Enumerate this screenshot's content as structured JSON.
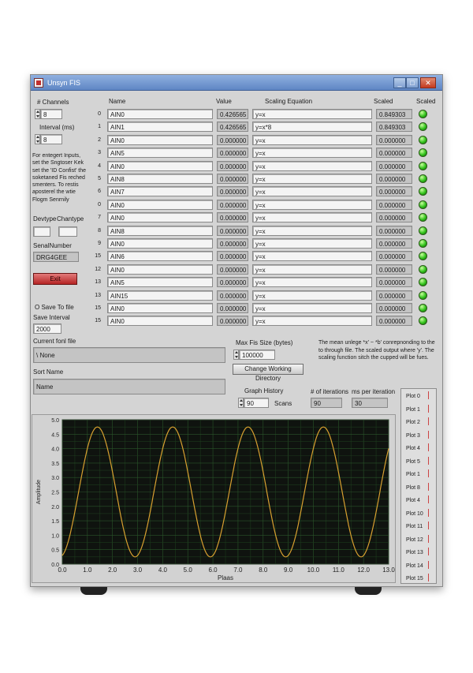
{
  "window": {
    "title": "Unsyn FIS"
  },
  "left_panel": {
    "channels_label": "# Channels",
    "channels_value": "8",
    "interval_label": "Interval (ms)",
    "interval_value": "8",
    "note": "For entegert Inputs, set the Sngtoser Kek set the 'ID Confist' the soketaned Fis reched smenters. To restis aposterel the wtie Flogm Senrnily",
    "devtype_label": "Devtype",
    "chantype_label": "Chantype",
    "devtype_value": "",
    "chantype_value": "",
    "serialnumber_label": "SenalNumber",
    "serialnumber_value": "DRG4GEE",
    "exit_label": "Exit",
    "save_label": "O Save To file",
    "save_interval_label": "Save Interval",
    "save_interval_value": "2000"
  },
  "table": {
    "headers": {
      "name": "Name",
      "value": "Value",
      "scaling": "Scaling Equation",
      "scaled": "Scaled",
      "status": "Scaled"
    },
    "rows": [
      {
        "idx": "0",
        "name": "AIN0",
        "value": "0.426565",
        "scaling": "y=x",
        "scaled": "0.849303"
      },
      {
        "idx": "1",
        "name": "AIN1",
        "value": "0.426565",
        "scaling": "y=x*8",
        "scaled": "0.849303"
      },
      {
        "idx": "2",
        "name": "AIN0",
        "value": "0.000000",
        "scaling": "y=x",
        "scaled": "0.000000"
      },
      {
        "idx": "3",
        "name": "AIN5",
        "value": "0.000000",
        "scaling": "y=x",
        "scaled": "0.000000"
      },
      {
        "idx": "4",
        "name": "AIN0",
        "value": "0.000000",
        "scaling": "y=x",
        "scaled": "0.000000"
      },
      {
        "idx": "5",
        "name": "AIN8",
        "value": "0.000000",
        "scaling": "y=x",
        "scaled": "0.000000"
      },
      {
        "idx": "6",
        "name": "AIN7",
        "value": "0.000000",
        "scaling": "y=x",
        "scaled": "0.000000"
      },
      {
        "idx": "0",
        "name": "AIN0",
        "value": "0.000000",
        "scaling": "y=x",
        "scaled": "0.000000"
      },
      {
        "idx": "7",
        "name": "AIN0",
        "value": "0.000000",
        "scaling": "y=x",
        "scaled": "0.000000"
      },
      {
        "idx": "8",
        "name": "AIN8",
        "value": "0.000000",
        "scaling": "y=x",
        "scaled": "0.000000"
      },
      {
        "idx": "9",
        "name": "AIN0",
        "value": "0.000000",
        "scaling": "y=x",
        "scaled": "0.000000"
      },
      {
        "idx": "15",
        "name": "AIN6",
        "value": "0.000000",
        "scaling": "y=x",
        "scaled": "0.000000"
      },
      {
        "idx": "12",
        "name": "AIN0",
        "value": "0.000000",
        "scaling": "y=x",
        "scaled": "0.000000"
      },
      {
        "idx": "13",
        "name": "AIN5",
        "value": "0.000000",
        "scaling": "y=x",
        "scaled": "0.000000"
      },
      {
        "idx": "13",
        "name": "AIN15",
        "value": "0.000000",
        "scaling": "y=x",
        "scaled": "0.000000"
      },
      {
        "idx": "15",
        "name": "AIN0",
        "value": "0.000000",
        "scaling": "y=x",
        "scaled": "0.000000"
      },
      {
        "idx": "15",
        "name": "AIN0",
        "value": "0.000000",
        "scaling": "y=x",
        "scaled": "0.000000"
      }
    ]
  },
  "middle": {
    "current_file_label": "Current fonl file",
    "current_file_value": "\\ None",
    "short_name_label": "Sort Name",
    "short_name_value": "Name",
    "max_size_label": "Max Fis Size (bytes)",
    "max_size_value": "100000",
    "change_dir_label": "Change Working Directory",
    "help_text": "The mean unlege *x' ~ *b' conrepnonding to the to through file. The scaled output where 'y'. The scaling function sitch the cupped will be fues.",
    "graph_history_label": "Graph History",
    "graph_history_value": "90",
    "graph_history_unit": "Scans",
    "num_iterations_label": "# of iterations",
    "num_iterations_value": "90",
    "ms_per_iteration_label": "ms per iteration",
    "ms_per_iteration_value": "30"
  },
  "plots": [
    "Plot 0",
    "Plot 1",
    "Plot 2",
    "Plot 3",
    "Plot 4",
    "Plot 5",
    "Plot 1",
    "Plot 8",
    "Plot 4",
    "Plot 10",
    "Plot 11",
    "Plot 12",
    "Plot 13",
    "Plot 14",
    "Plot 15"
  ],
  "colors": {
    "led_on": "#32c21c",
    "plot_bg": "#0f130f",
    "trace": "#d8a030",
    "exit": "#c43030"
  },
  "chart_data": {
    "type": "line",
    "xlabel": "Plaas",
    "ylabel": "Amplitude",
    "xlim": [
      0,
      130
    ],
    "ylim": [
      0,
      5
    ],
    "xticks": [
      "0.0",
      "1.0",
      "2.0",
      "3.0",
      "4.0",
      "5.0",
      "6.0",
      "7.0",
      "8.0",
      "9.0",
      "10.0",
      "11.0",
      "12.0",
      "13.0"
    ],
    "yticks": [
      "0.0",
      "0.5",
      "1.0",
      "1.5",
      "2.0",
      "2.5",
      "3.0",
      "3.5",
      "4.0",
      "4.5",
      "5.0"
    ],
    "grid": true,
    "series": [
      {
        "name": "",
        "period": 30,
        "center": 2.5,
        "amplitude": 2.25,
        "phase_x": 6.5,
        "x": [
          0,
          5,
          10,
          15,
          20,
          25,
          30,
          35,
          40,
          45,
          50,
          55,
          60,
          65,
          70,
          75,
          80,
          85,
          90,
          95,
          100,
          105,
          110,
          115,
          120,
          125,
          130
        ]
      }
    ]
  }
}
